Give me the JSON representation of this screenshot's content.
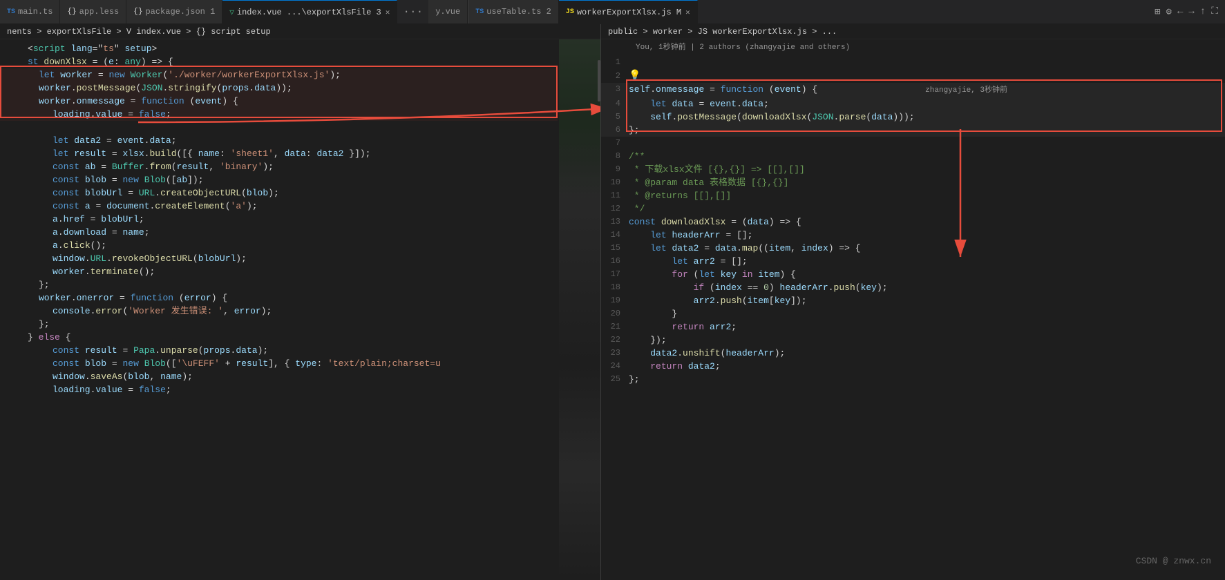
{
  "tabs_left": [
    {
      "id": "main-ts",
      "icon": "TS",
      "icon_color": "#3178c6",
      "label": "main.ts",
      "active": false,
      "modified": false
    },
    {
      "id": "app-less",
      "icon": "{}",
      "icon_color": "#d4d4d4",
      "label": "app.less",
      "active": false,
      "modified": false
    },
    {
      "id": "package-json",
      "icon": "{}",
      "icon_color": "#d4d4d4",
      "label": "package.json 1",
      "active": false,
      "modified": false
    },
    {
      "id": "index-vue",
      "icon": "V",
      "icon_color": "#42b883",
      "label": "index.vue ...\\exportXlsFile 3",
      "active": true,
      "modified": false,
      "closable": true
    },
    {
      "id": "more",
      "label": "..."
    },
    {
      "id": "y-vue",
      "icon": "",
      "label": "y.vue",
      "active": false
    }
  ],
  "tabs_right": [
    {
      "id": "usetable",
      "icon": "TS",
      "icon_color": "#3178c6",
      "label": "useTable.ts 2",
      "active": false
    },
    {
      "id": "worker-export",
      "icon": "JS",
      "icon_color": "#f7df1e",
      "label": "workerExportXlsx.js M",
      "active": true,
      "closable": true
    }
  ],
  "breadcrumb_left": "nents > exportXlsFile > V index.vue > {} script setup",
  "breadcrumb_right": "public > worker > JS workerExportXlsx.js > ...",
  "blame_info": "You, 1秒钟前 | 2 authors (zhangyajie and others)",
  "left_code": [
    {
      "n": "",
      "text": "<script lang=\"ts\" setup>"
    },
    {
      "n": "",
      "text": "st downXlsx = (e: any) => {"
    },
    {
      "n": "",
      "indent": 1,
      "text": "let worker = new Worker('./worker/workerExportXlsx.js');"
    },
    {
      "n": "",
      "indent": 1,
      "text": "worker.postMessage(JSON.stringify(props.data));"
    },
    {
      "n": "",
      "indent": 1,
      "text": "worker.onmessage = function (event) {"
    },
    {
      "n": "",
      "indent": 2,
      "text": "loading.value = false;"
    },
    {
      "n": "",
      "indent": 2,
      "text": ""
    },
    {
      "n": "",
      "indent": 2,
      "text": "let data2 = event.data;"
    },
    {
      "n": "",
      "indent": 2,
      "text": "let result = xlsx.build([{ name: 'sheet1', data: data2 }]);"
    },
    {
      "n": "",
      "indent": 2,
      "text": "const ab = Buffer.from(result, 'binary');"
    },
    {
      "n": "",
      "indent": 2,
      "text": "const blob = new Blob([ab]);"
    },
    {
      "n": "",
      "indent": 2,
      "text": "const blobUrl = URL.createObjectURL(blob);"
    },
    {
      "n": "",
      "indent": 2,
      "text": "const a = document.createElement('a');"
    },
    {
      "n": "",
      "indent": 2,
      "text": "a.href = blobUrl;"
    },
    {
      "n": "",
      "indent": 2,
      "text": "a.download = name;"
    },
    {
      "n": "",
      "indent": 2,
      "text": "a.click();"
    },
    {
      "n": "",
      "indent": 2,
      "text": "window.URL.revokeObjectURL(blobUrl);"
    },
    {
      "n": "",
      "indent": 2,
      "text": "worker.terminate();"
    },
    {
      "n": "",
      "indent": 1,
      "text": "};"
    },
    {
      "n": "",
      "indent": 1,
      "text": "worker.onerror = function (error) {"
    },
    {
      "n": "",
      "indent": 2,
      "text": "console.error('Worker 发生错误: ', error);"
    },
    {
      "n": "",
      "indent": 1,
      "text": "};"
    },
    {
      "n": "",
      "text": "} else {"
    },
    {
      "n": "",
      "indent": 2,
      "text": "const result = Papa.unparse(props.data);"
    },
    {
      "n": "",
      "indent": 2,
      "text": "const blob = new Blob(['\\uFEFF' + result], { type: 'text/plain;charset=u"
    },
    {
      "n": "",
      "indent": 2,
      "text": "window.saveAs(blob, name);"
    },
    {
      "n": "",
      "indent": 2,
      "text": "loading.value = false;"
    }
  ],
  "right_code": [
    {
      "n": "1",
      "text": ""
    },
    {
      "n": "2",
      "text": "",
      "bulb": true
    },
    {
      "n": "3",
      "text": "self.onmessage = function (event) {",
      "highlight": true,
      "blame": "zhangyajie, 3秒钟前"
    },
    {
      "n": "4",
      "text": "    let data = event.data;",
      "highlight": true
    },
    {
      "n": "5",
      "text": "    self.postMessage(downloadXlsx(JSON.parse(data)));",
      "highlight": true
    },
    {
      "n": "6",
      "text": "};",
      "highlight": true
    },
    {
      "n": "7",
      "text": ""
    },
    {
      "n": "8",
      "text": "/**"
    },
    {
      "n": "9",
      "text": " * 下载xlsx文件 [{},{}] => [[],[]]"
    },
    {
      "n": "10",
      "text": " * @param data 表格数据 [{},{}]"
    },
    {
      "n": "11",
      "text": " * @returns [[],[]]"
    },
    {
      "n": "12",
      "text": " */"
    },
    {
      "n": "13",
      "text": "const downloadXlsx = (data) => {"
    },
    {
      "n": "14",
      "text": "    let headerArr = [];"
    },
    {
      "n": "15",
      "text": "    let data2 = data.map((item, index) => {"
    },
    {
      "n": "16",
      "text": "        let arr2 = [];"
    },
    {
      "n": "17",
      "text": "        for (let key in item) {"
    },
    {
      "n": "18",
      "text": "            if (index == 0) headerArr.push(key);"
    },
    {
      "n": "19",
      "text": "            arr2.push(item[key]);"
    },
    {
      "n": "20",
      "text": "        }"
    },
    {
      "n": "21",
      "text": "        return arr2;"
    },
    {
      "n": "22",
      "text": "    });"
    },
    {
      "n": "23",
      "text": "    data2.unshift(headerArr);"
    },
    {
      "n": "24",
      "text": "    return data2;"
    },
    {
      "n": "25",
      "text": "};"
    }
  ],
  "watermark": "CSDN @ znwx.cn",
  "colors": {
    "bg": "#1e1e1e",
    "tab_active_bg": "#1e1e1e",
    "tab_inactive_bg": "#2d2d2d",
    "accent": "#0078d4",
    "red": "#e74c3c",
    "keyword": "#569cd6",
    "function_color": "#dcdcaa",
    "string": "#ce9178",
    "variable": "#9cdcfe",
    "comment": "#6a9955",
    "number": "#b5cea8",
    "control": "#c586c0"
  }
}
